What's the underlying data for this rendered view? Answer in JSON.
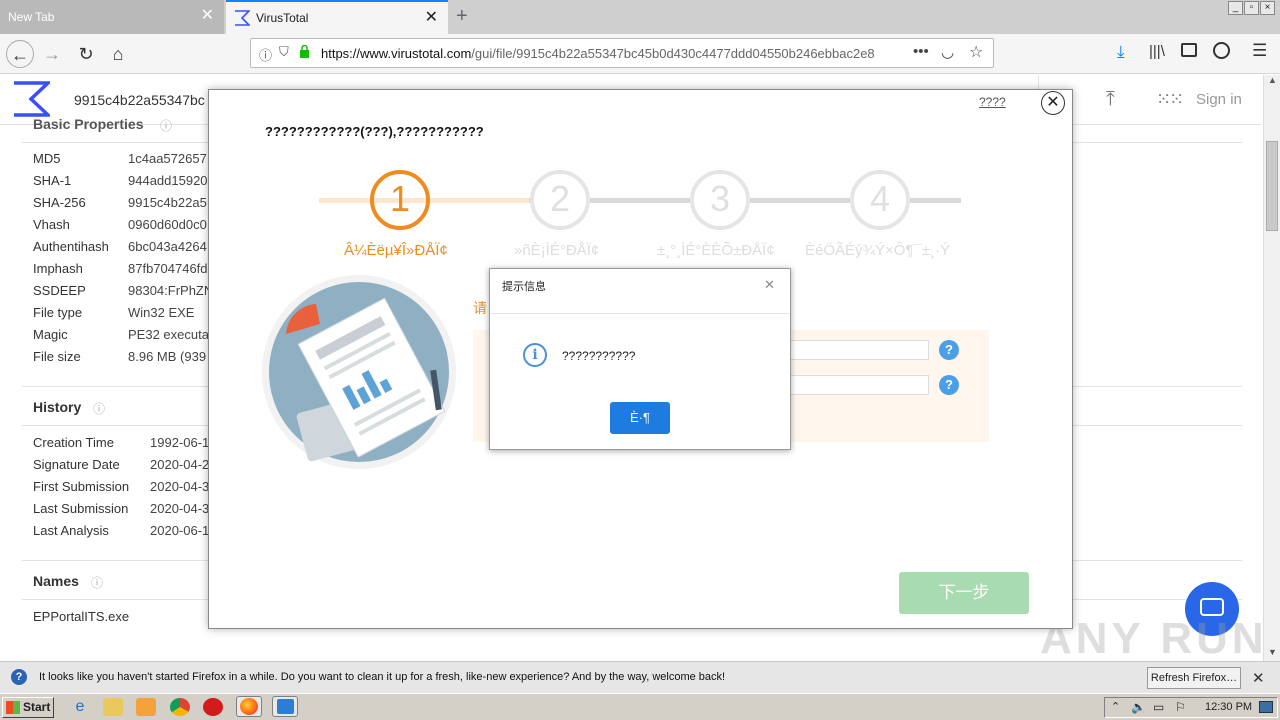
{
  "browser": {
    "tabs": [
      {
        "label": "New Tab",
        "active": false
      },
      {
        "label": "VirusTotal",
        "active": true
      }
    ],
    "url_host": "https://www.virustotal.com",
    "url_path": "/gui/file/9915c4b22a55347bc45b0d430c4477ddd04550b246ebbac2e8",
    "window_controls": [
      "_",
      "▫",
      "×"
    ]
  },
  "vt": {
    "hash_title": "9915c4b22a55347bc",
    "sign_in": "Sign in",
    "basic_properties_title": "Basic Properties",
    "basic_properties": [
      {
        "key": "MD5",
        "value": "1c4aa572657"
      },
      {
        "key": "SHA-1",
        "value": "944add15920"
      },
      {
        "key": "SHA-256",
        "value": "9915c4b22a5"
      },
      {
        "key": "Vhash",
        "value": "0960d60d0c0"
      },
      {
        "key": "Authentihash",
        "value": "6bc043a4264"
      },
      {
        "key": "Imphash",
        "value": "87fb704746fd2"
      },
      {
        "key": "SSDEEP",
        "value": "98304:FrPhZN"
      },
      {
        "key": "File type",
        "value": "Win32 EXE"
      },
      {
        "key": "Magic",
        "value": "PE32 executa"
      },
      {
        "key": "File size",
        "value": "8.96 MB (939"
      }
    ],
    "history_title": "History",
    "history": [
      {
        "key": "Creation Time",
        "value": "1992-06-1"
      },
      {
        "key": "Signature Date",
        "value": "2020-04-2"
      },
      {
        "key": "First Submission",
        "value": "2020-04-3"
      },
      {
        "key": "Last Submission",
        "value": "2020-04-3"
      },
      {
        "key": "Last Analysis",
        "value": "2020-06-1"
      }
    ],
    "names_title": "Names",
    "names": [
      "EPPortalITS.exe"
    ]
  },
  "modal": {
    "top_link": "????",
    "heading": "????????????(???),???????????",
    "steps": [
      {
        "num": "1",
        "label": "Â¼Èëµ¥Î»ÐÅÏ¢",
        "active": true
      },
      {
        "num": "2",
        "label": "»ñÈ¡ÌÉ°ÐÅÏ¢",
        "active": false
      },
      {
        "num": "3",
        "label": "±¸°¸ÌÉ°ÈÈÕ±ÐÅÏ¢",
        "active": false
      },
      {
        "num": "4",
        "label": "ÈéÖÃÉý¾Ý×Ô¶¯±¸·Ý",
        "active": false
      }
    ],
    "form_hint": "请",
    "next_button": "下一步",
    "accent_color": "#f08c1e",
    "next_color": "#a8dcb0"
  },
  "dialog": {
    "title": "提示信息",
    "message": "???????????",
    "ok_button": "È·¶",
    "ok_color": "#1e7be0"
  },
  "notification": {
    "text": "It looks like you haven't started Firefox in a while. Do you want to clean it up for a fresh, like-new experience? And by the way, welcome back!",
    "button": "Refresh Firefox…"
  },
  "taskbar": {
    "start": "Start",
    "clock": "12:30 PM"
  },
  "watermark": "ANY RUN"
}
